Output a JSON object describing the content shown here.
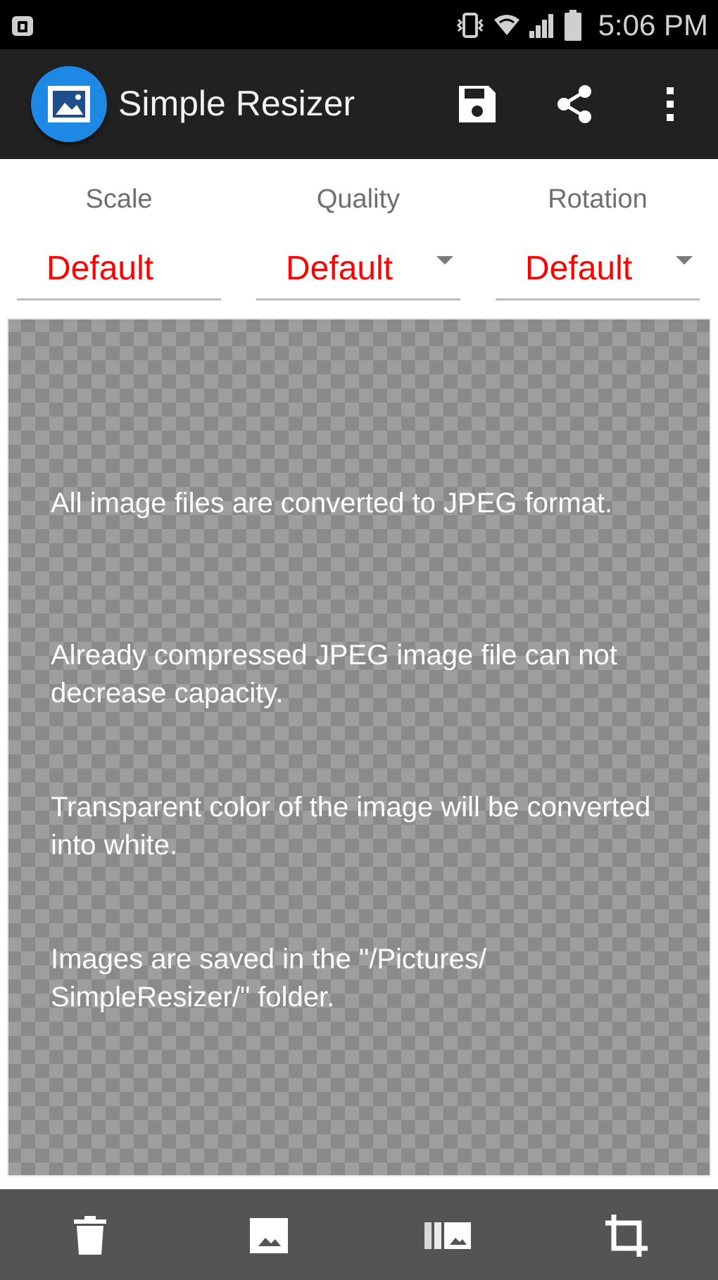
{
  "status_bar": {
    "time": "5:06 PM",
    "icons": [
      "notification-app-icon",
      "vibrate-icon",
      "wifi-icon",
      "signal-icon",
      "battery-icon"
    ]
  },
  "action_bar": {
    "title": "Simple Resizer",
    "actions": [
      "save-icon",
      "share-icon",
      "overflow-menu-icon"
    ]
  },
  "settings": [
    {
      "label": "Scale",
      "value": "Default",
      "dropdown": false
    },
    {
      "label": "Quality",
      "value": "Default",
      "dropdown": true
    },
    {
      "label": "Rotation",
      "value": "Default",
      "dropdown": true
    }
  ],
  "info_messages": [
    "All image files are converted to JPEG format.",
    "Already compressed JPEG image file can not decrease capacity.",
    "Transparent color of the image will be converted into white.",
    "Images are saved in the \"/Pictures/ SimpleResizer/\" folder."
  ],
  "bottom_toolbar": {
    "actions": [
      "delete-icon",
      "image-icon",
      "image-gallery-icon",
      "crop-icon"
    ]
  },
  "colors": {
    "value_red": "#ff0000",
    "app_bar": "#212121",
    "bottom_bar": "#545454",
    "logo_blue": "#1e88e5"
  }
}
